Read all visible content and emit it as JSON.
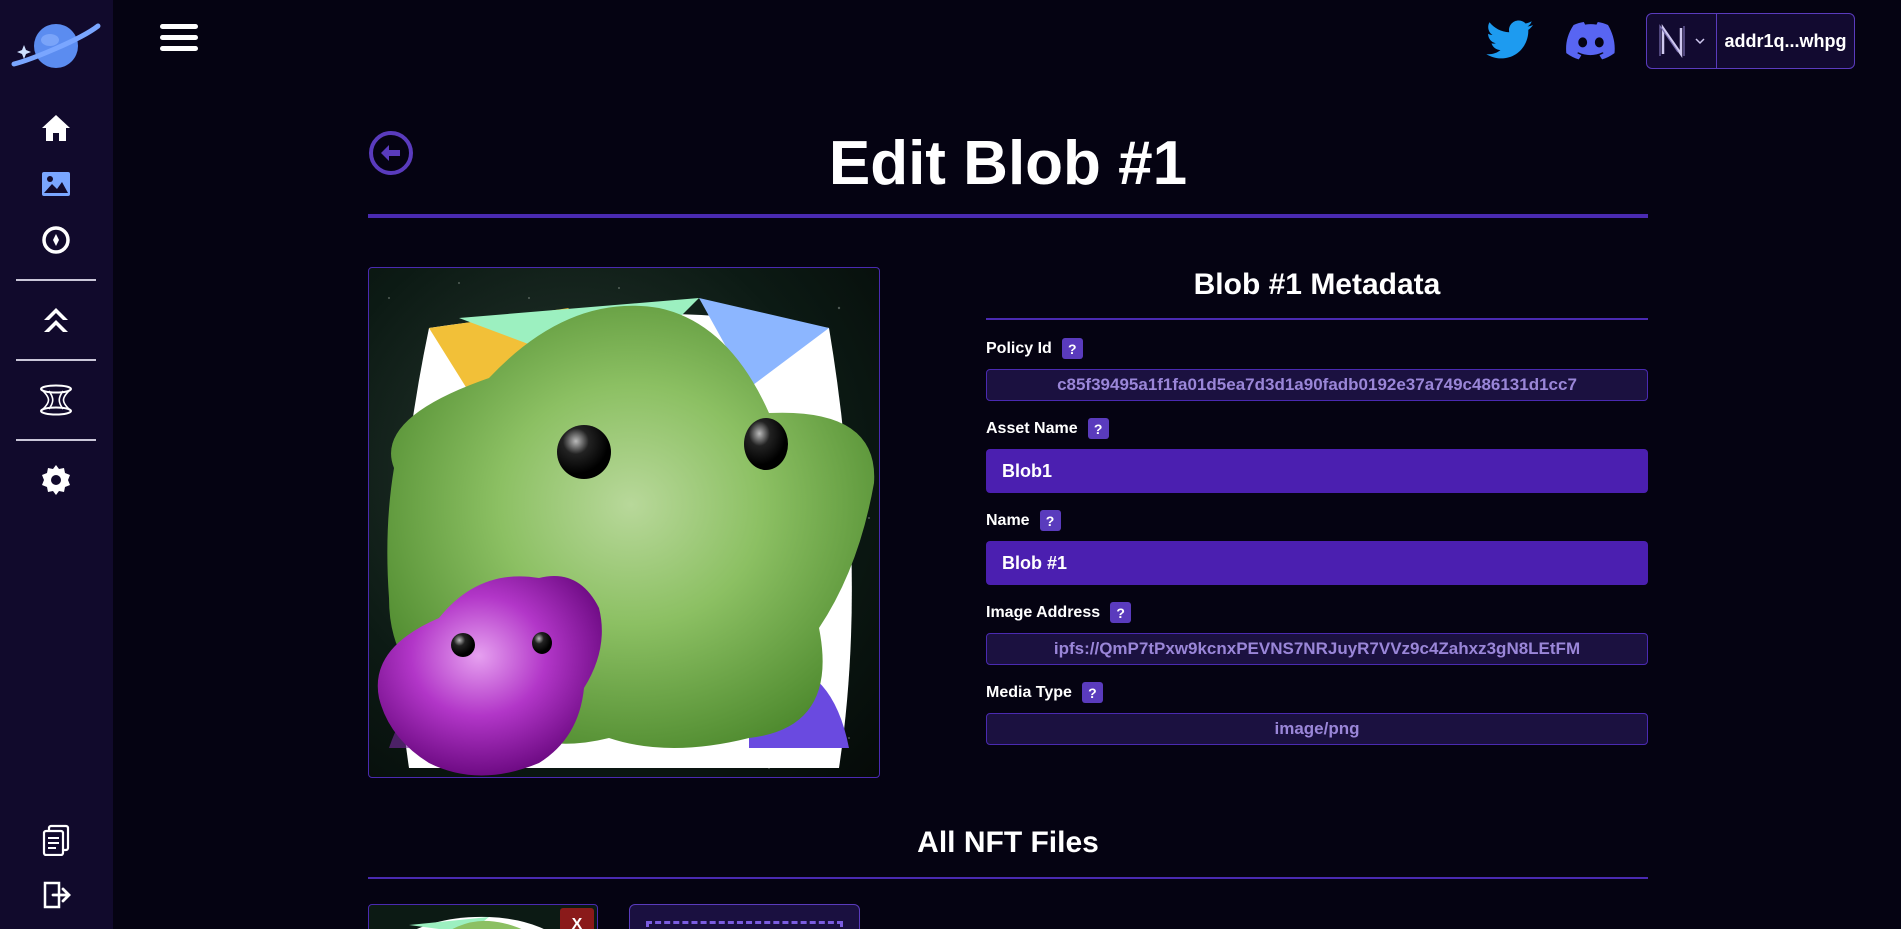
{
  "sidebar": {
    "items": [
      {
        "icon": "home-icon"
      },
      {
        "icon": "image-icon"
      },
      {
        "icon": "compass-icon"
      },
      {
        "icon": "chevrons-up-icon"
      },
      {
        "icon": "wormhole-icon"
      },
      {
        "icon": "gear-icon"
      },
      {
        "icon": "document-icon"
      },
      {
        "icon": "logout-icon"
      }
    ]
  },
  "header": {
    "wallet_address": "addr1q...whpg",
    "social": [
      "twitter-icon",
      "discord-icon"
    ]
  },
  "page": {
    "title": "Edit Blob #1"
  },
  "metadata": {
    "title": "Blob #1 Metadata",
    "help_label": "?",
    "policy_id_label": "Policy Id",
    "policy_id_value": "c85f39495a1f1fa01d5ea7d3d1a90fadb0192e37a749c486131d1cc7",
    "asset_name_label": "Asset Name",
    "asset_name_value": "Blob1",
    "name_label": "Name",
    "name_value": "Blob #1",
    "image_address_label": "Image Address",
    "image_address_value": "ipfs://QmP7tPxw9kcnxPEVNS7NRJuyR7VVz9c4Zahxz3gN8LEtFM",
    "media_type_label": "Media Type",
    "media_type_value": "image/png"
  },
  "files": {
    "title": "All NFT Files",
    "remove_label": "X"
  },
  "colors": {
    "background": "#050312",
    "sidebar": "#110a2c",
    "accent": "#4a2ab1",
    "input": "#4b1fb0",
    "twitter": "#1d9bf0",
    "discord": "#5865f2"
  }
}
